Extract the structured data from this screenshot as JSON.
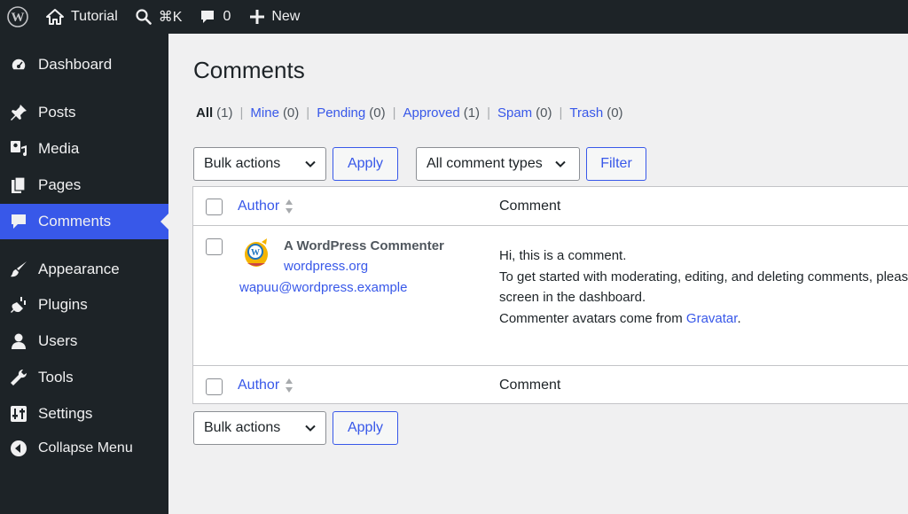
{
  "adminbar": {
    "site_name": "Tutorial",
    "search_shortcut": "⌘K",
    "comments_count": "0",
    "new_label": "New"
  },
  "sidebar": {
    "items": [
      {
        "label": "Dashboard",
        "icon": "dashboard-icon"
      },
      {
        "label": "Posts",
        "icon": "pin-icon"
      },
      {
        "label": "Media",
        "icon": "media-icon"
      },
      {
        "label": "Pages",
        "icon": "pages-icon"
      },
      {
        "label": "Comments",
        "icon": "comment-icon",
        "current": true
      },
      {
        "label": "Appearance",
        "icon": "brush-icon"
      },
      {
        "label": "Plugins",
        "icon": "plugin-icon"
      },
      {
        "label": "Users",
        "icon": "user-icon"
      },
      {
        "label": "Tools",
        "icon": "wrench-icon"
      },
      {
        "label": "Settings",
        "icon": "settings-icon"
      },
      {
        "label": "Collapse Menu",
        "icon": "collapse-icon"
      }
    ]
  },
  "page": {
    "title": "Comments",
    "filters": [
      {
        "label": "All",
        "count": "(1)",
        "current": true
      },
      {
        "label": "Mine",
        "count": "(0)"
      },
      {
        "label": "Pending",
        "count": "(0)"
      },
      {
        "label": "Approved",
        "count": "(1)"
      },
      {
        "label": "Spam",
        "count": "(0)"
      },
      {
        "label": "Trash",
        "count": "(0)"
      }
    ],
    "bulk_actions": "Bulk actions",
    "apply": "Apply",
    "comment_types": "All comment types",
    "filter": "Filter"
  },
  "table": {
    "col_author": "Author",
    "col_comment": "Comment",
    "rows": [
      {
        "author_name": "A WordPress Commenter",
        "author_url": "wordpress.org",
        "author_email": "wapuu@wordpress.example",
        "lines": [
          "Hi, this is a comment.",
          "To get started with moderating, editing, and deleting comments, please visit the Comments",
          "screen in the dashboard.",
          "Commenter avatars come from"
        ],
        "link_text": "Gravatar",
        "after_link": "."
      }
    ]
  },
  "colors": {
    "adminbar_bg": "#1d2327",
    "accent": "#3858e9",
    "page_bg": "#f0f0f1"
  }
}
